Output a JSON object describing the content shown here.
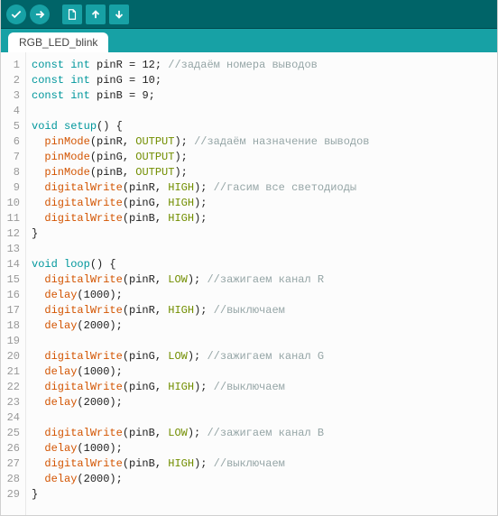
{
  "toolbar": {
    "verify": "verify",
    "upload": "upload",
    "new": "new",
    "open": "open",
    "save": "save"
  },
  "tab": {
    "name": "RGB_LED_blink"
  },
  "code": {
    "lines": [
      [
        {
          "t": "const ",
          "c": "kw"
        },
        {
          "t": "int ",
          "c": "ty"
        },
        {
          "t": "pinR = 12; ",
          "c": "nm"
        },
        {
          "t": "//задаём номера выводов",
          "c": "cm"
        }
      ],
      [
        {
          "t": "const ",
          "c": "kw"
        },
        {
          "t": "int ",
          "c": "ty"
        },
        {
          "t": "pinG = 10;",
          "c": "nm"
        }
      ],
      [
        {
          "t": "const ",
          "c": "kw"
        },
        {
          "t": "int ",
          "c": "ty"
        },
        {
          "t": "pinB = 9;",
          "c": "nm"
        }
      ],
      [],
      [
        {
          "t": "void ",
          "c": "kw"
        },
        {
          "t": "setup",
          "c": "ty"
        },
        {
          "t": "() {",
          "c": "nm"
        }
      ],
      [
        {
          "t": "  ",
          "c": "nm"
        },
        {
          "t": "pinMode",
          "c": "fn"
        },
        {
          "t": "(pinR, ",
          "c": "nm"
        },
        {
          "t": "OUTPUT",
          "c": "co"
        },
        {
          "t": "); ",
          "c": "nm"
        },
        {
          "t": "//задаём назначение выводов",
          "c": "cm"
        }
      ],
      [
        {
          "t": "  ",
          "c": "nm"
        },
        {
          "t": "pinMode",
          "c": "fn"
        },
        {
          "t": "(pinG, ",
          "c": "nm"
        },
        {
          "t": "OUTPUT",
          "c": "co"
        },
        {
          "t": ");",
          "c": "nm"
        }
      ],
      [
        {
          "t": "  ",
          "c": "nm"
        },
        {
          "t": "pinMode",
          "c": "fn"
        },
        {
          "t": "(pinB, ",
          "c": "nm"
        },
        {
          "t": "OUTPUT",
          "c": "co"
        },
        {
          "t": ");",
          "c": "nm"
        }
      ],
      [
        {
          "t": "  ",
          "c": "nm"
        },
        {
          "t": "digitalWrite",
          "c": "fn"
        },
        {
          "t": "(pinR, ",
          "c": "nm"
        },
        {
          "t": "HIGH",
          "c": "co"
        },
        {
          "t": "); ",
          "c": "nm"
        },
        {
          "t": "//гасим все светодиоды",
          "c": "cm"
        }
      ],
      [
        {
          "t": "  ",
          "c": "nm"
        },
        {
          "t": "digitalWrite",
          "c": "fn"
        },
        {
          "t": "(pinG, ",
          "c": "nm"
        },
        {
          "t": "HIGH",
          "c": "co"
        },
        {
          "t": ");",
          "c": "nm"
        }
      ],
      [
        {
          "t": "  ",
          "c": "nm"
        },
        {
          "t": "digitalWrite",
          "c": "fn"
        },
        {
          "t": "(pinB, ",
          "c": "nm"
        },
        {
          "t": "HIGH",
          "c": "co"
        },
        {
          "t": ");",
          "c": "nm"
        }
      ],
      [
        {
          "t": "}",
          "c": "nm"
        }
      ],
      [],
      [
        {
          "t": "void ",
          "c": "kw"
        },
        {
          "t": "loop",
          "c": "ty"
        },
        {
          "t": "() {",
          "c": "nm"
        }
      ],
      [
        {
          "t": "  ",
          "c": "nm"
        },
        {
          "t": "digitalWrite",
          "c": "fn"
        },
        {
          "t": "(pinR, ",
          "c": "nm"
        },
        {
          "t": "LOW",
          "c": "co"
        },
        {
          "t": "); ",
          "c": "nm"
        },
        {
          "t": "//зажигаем канал R",
          "c": "cm"
        }
      ],
      [
        {
          "t": "  ",
          "c": "nm"
        },
        {
          "t": "delay",
          "c": "fn"
        },
        {
          "t": "(1000);",
          "c": "nm"
        }
      ],
      [
        {
          "t": "  ",
          "c": "nm"
        },
        {
          "t": "digitalWrite",
          "c": "fn"
        },
        {
          "t": "(pinR, ",
          "c": "nm"
        },
        {
          "t": "HIGH",
          "c": "co"
        },
        {
          "t": "); ",
          "c": "nm"
        },
        {
          "t": "//выключаем",
          "c": "cm"
        }
      ],
      [
        {
          "t": "  ",
          "c": "nm"
        },
        {
          "t": "delay",
          "c": "fn"
        },
        {
          "t": "(2000);",
          "c": "nm"
        }
      ],
      [],
      [
        {
          "t": "  ",
          "c": "nm"
        },
        {
          "t": "digitalWrite",
          "c": "fn"
        },
        {
          "t": "(pinG, ",
          "c": "nm"
        },
        {
          "t": "LOW",
          "c": "co"
        },
        {
          "t": "); ",
          "c": "nm"
        },
        {
          "t": "//зажигаем канал G",
          "c": "cm"
        }
      ],
      [
        {
          "t": "  ",
          "c": "nm"
        },
        {
          "t": "delay",
          "c": "fn"
        },
        {
          "t": "(1000);",
          "c": "nm"
        }
      ],
      [
        {
          "t": "  ",
          "c": "nm"
        },
        {
          "t": "digitalWrite",
          "c": "fn"
        },
        {
          "t": "(pinG, ",
          "c": "nm"
        },
        {
          "t": "HIGH",
          "c": "co"
        },
        {
          "t": "); ",
          "c": "nm"
        },
        {
          "t": "//выключаем",
          "c": "cm"
        }
      ],
      [
        {
          "t": "  ",
          "c": "nm"
        },
        {
          "t": "delay",
          "c": "fn"
        },
        {
          "t": "(2000);",
          "c": "nm"
        }
      ],
      [],
      [
        {
          "t": "  ",
          "c": "nm"
        },
        {
          "t": "digitalWrite",
          "c": "fn"
        },
        {
          "t": "(pinB, ",
          "c": "nm"
        },
        {
          "t": "LOW",
          "c": "co"
        },
        {
          "t": "); ",
          "c": "nm"
        },
        {
          "t": "//зажигаем канал B",
          "c": "cm"
        }
      ],
      [
        {
          "t": "  ",
          "c": "nm"
        },
        {
          "t": "delay",
          "c": "fn"
        },
        {
          "t": "(1000);",
          "c": "nm"
        }
      ],
      [
        {
          "t": "  ",
          "c": "nm"
        },
        {
          "t": "digitalWrite",
          "c": "fn"
        },
        {
          "t": "(pinB, ",
          "c": "nm"
        },
        {
          "t": "HIGH",
          "c": "co"
        },
        {
          "t": "); ",
          "c": "nm"
        },
        {
          "t": "//выключаем",
          "c": "cm"
        }
      ],
      [
        {
          "t": "  ",
          "c": "nm"
        },
        {
          "t": "delay",
          "c": "fn"
        },
        {
          "t": "(2000);",
          "c": "nm"
        }
      ],
      [
        {
          "t": "}",
          "c": "nm"
        }
      ]
    ]
  }
}
